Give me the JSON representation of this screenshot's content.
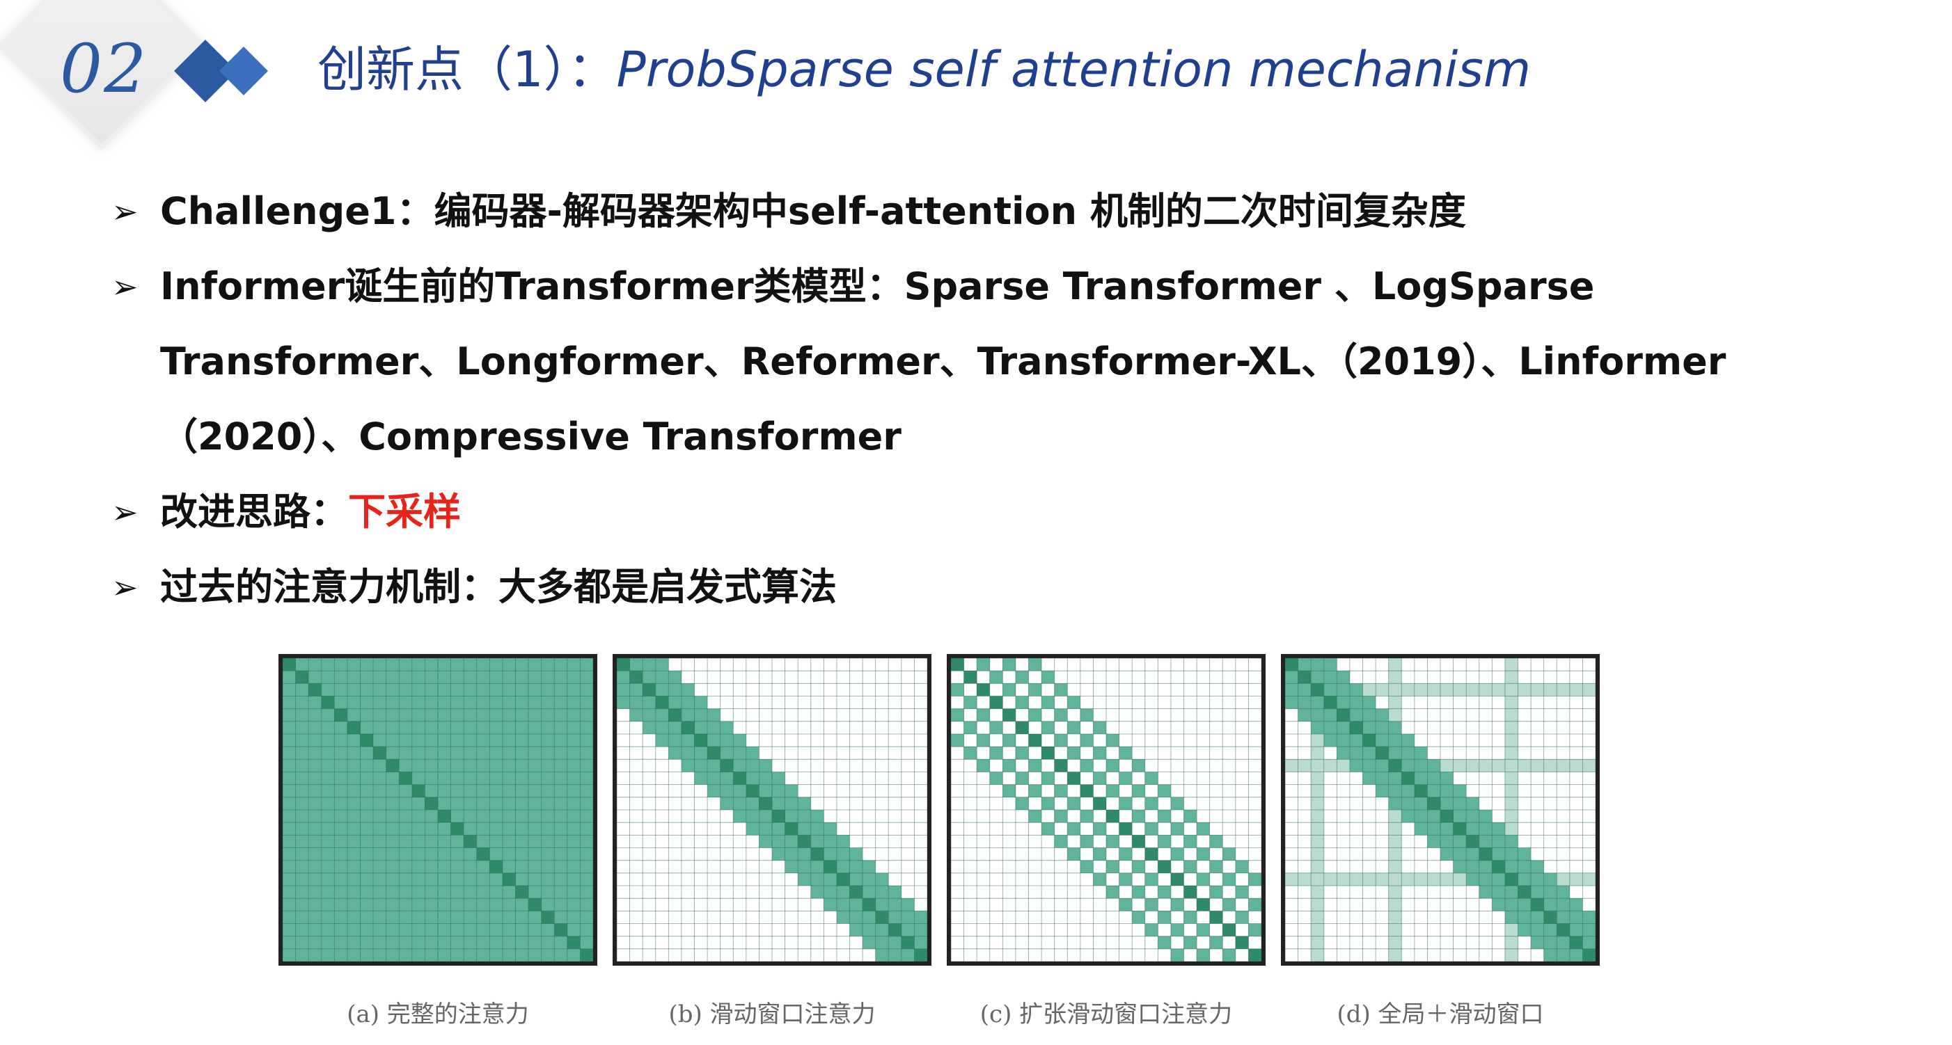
{
  "header": {
    "section_number": "02",
    "title_cn": "创新点（1）：",
    "title_en": "ProbSparse self attention mechanism"
  },
  "bullets": [
    {
      "text": "Challenge1：编码器-解码器架构中self-attention 机制的二次时间复杂度",
      "highlight": ""
    },
    {
      "text": "Informer诞生前的Transformer类模型：Sparse Transformer 、LogSparse Transformer、Longformer、Reformer、Transformer-XL、（2019）、Linformer（2020）、Compressive Transformer",
      "highlight": ""
    },
    {
      "text": "改进思路：",
      "highlight": "下采样"
    },
    {
      "text": "过去的注意力机制：大多都是启发式算法",
      "highlight": ""
    }
  ],
  "figure": {
    "captions": [
      "(a) 完整的注意力",
      "(b) 滑动窗口注意力",
      "(c) 扩张滑动窗口注意力",
      "(d) 全局＋滑动窗口"
    ],
    "colors": {
      "light": "#b9dccf",
      "medium": "#5fb49b",
      "dark": "#2f8a6a",
      "grid": "#1f5a47",
      "border": "#222222"
    }
  }
}
